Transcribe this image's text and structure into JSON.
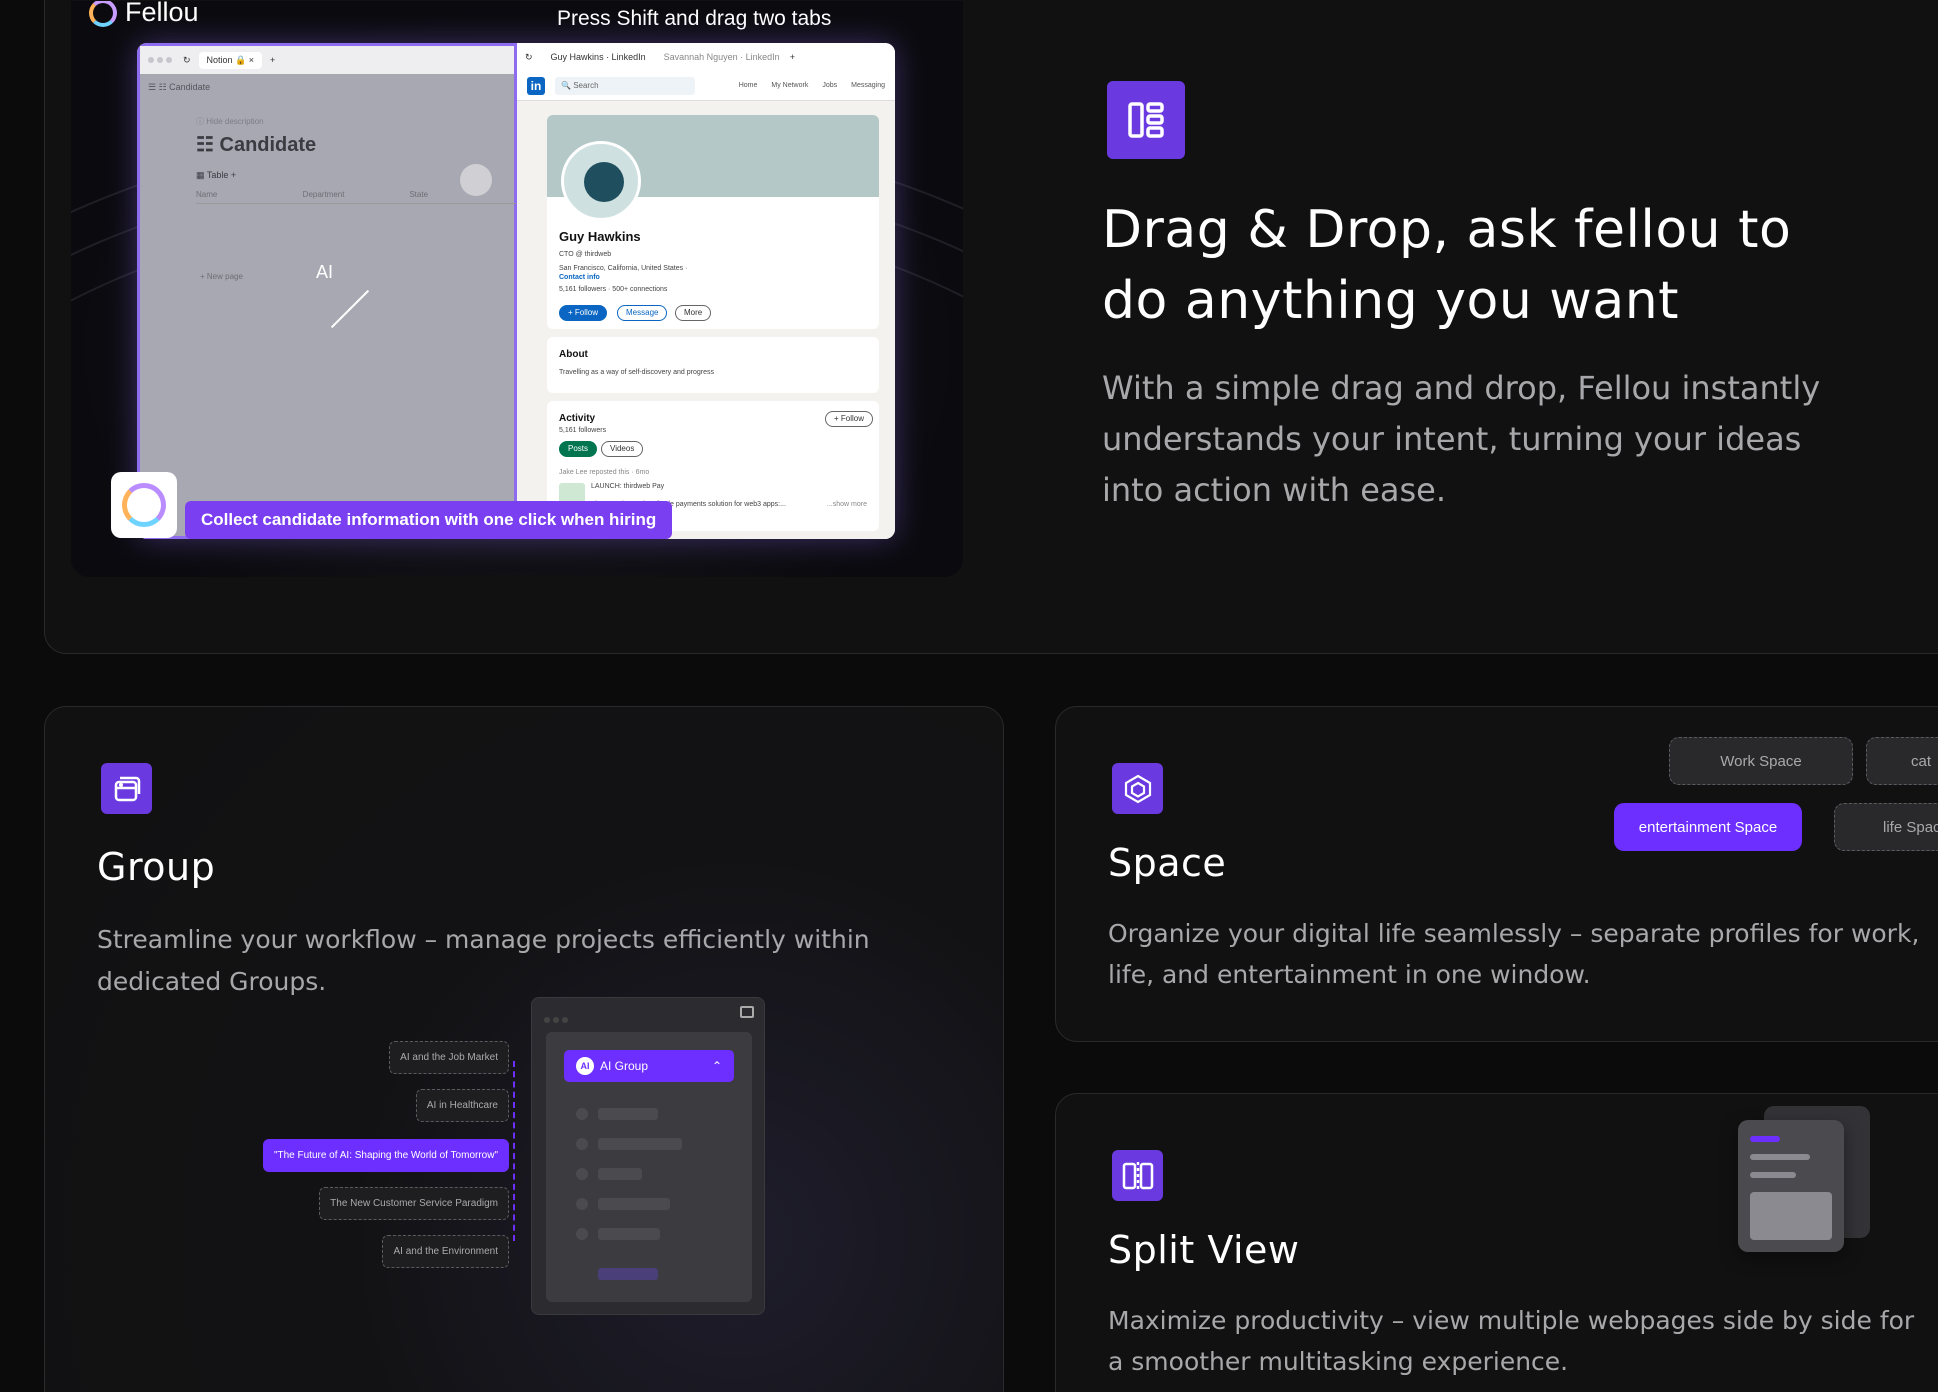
{
  "top_feature": {
    "brand": "Fellou",
    "demo_title": "Press Shift and drag two tabs",
    "notion": {
      "tab_label": "Notion",
      "breadcrumb": "Candidate",
      "hide_description": "Hide description",
      "title": "Candidate",
      "view_label": "Table",
      "columns": [
        "Name",
        "Department",
        "State"
      ],
      "new_page": "New page",
      "ai_label": "AI"
    },
    "linkedin": {
      "tab_1": "Guy Hawkins · LinkedIn",
      "tab_2": "Savannah Nguyen · LinkedIn",
      "search_placeholder": "Search",
      "nav_items": [
        "Home",
        "My Network",
        "Jobs",
        "Messaging"
      ],
      "name": "Guy Hawkins",
      "headline": "CTO @ thirdweb",
      "location": "San Francisco, California, United States ·",
      "contact": "Contact info",
      "connections": "5,161 followers · 500+ connections",
      "follow": "+ Follow",
      "message": "Message",
      "more": "More",
      "about_title": "About",
      "about_text": "Travelling as a way of self-discovery and progress",
      "activity_title": "Activity",
      "activity_followers": "5,161 followers",
      "activity_follow": "+ Follow",
      "tab_posts": "Posts",
      "tab_videos": "Videos",
      "repost_note": "Jake Lee reposted this · 6mo",
      "post_title": "LAUNCH: thirdweb Pay",
      "post_text": "The complete point-of-sale payments solution for web3 apps:...",
      "show_more": "...show more"
    },
    "caption": "Collect candidate information with one click when hiring",
    "title_line1": "Drag & Drop, ask fellou to",
    "title_line2": "do anything you want",
    "description": "With a simple drag and drop, Fellou instantly understands your intent, turning your ideas into action with ease."
  },
  "group_feature": {
    "title": "Group",
    "description": "Streamline your workflow – manage projects efficiently within dedicated Groups.",
    "topics": [
      "AI and the Job Market",
      "AI in Healthcare",
      "\"The Future of AI: Shaping the World of Tomorrow\"",
      "The New Customer Service Paradigm",
      "AI and the Environment"
    ],
    "active_topic_index": 2,
    "group_name": "AI Group",
    "group_badge": "AI"
  },
  "space_feature": {
    "title": "Space",
    "description": "Organize your digital life seamlessly – separate profiles for work, life, and entertainment in one window.",
    "tags": [
      "Work Space",
      "cat",
      "entertainment Space",
      "life Spac"
    ],
    "active_tag": "entertainment Space"
  },
  "split_feature": {
    "title": "Split View",
    "description": "Maximize productivity – view multiple webpages side by side for a smoother multitasking experience."
  },
  "colors": {
    "accent": "#6D2FFF",
    "icon_bg": "#6A3AE0",
    "background": "#0B0B0C",
    "card": "#111112"
  }
}
